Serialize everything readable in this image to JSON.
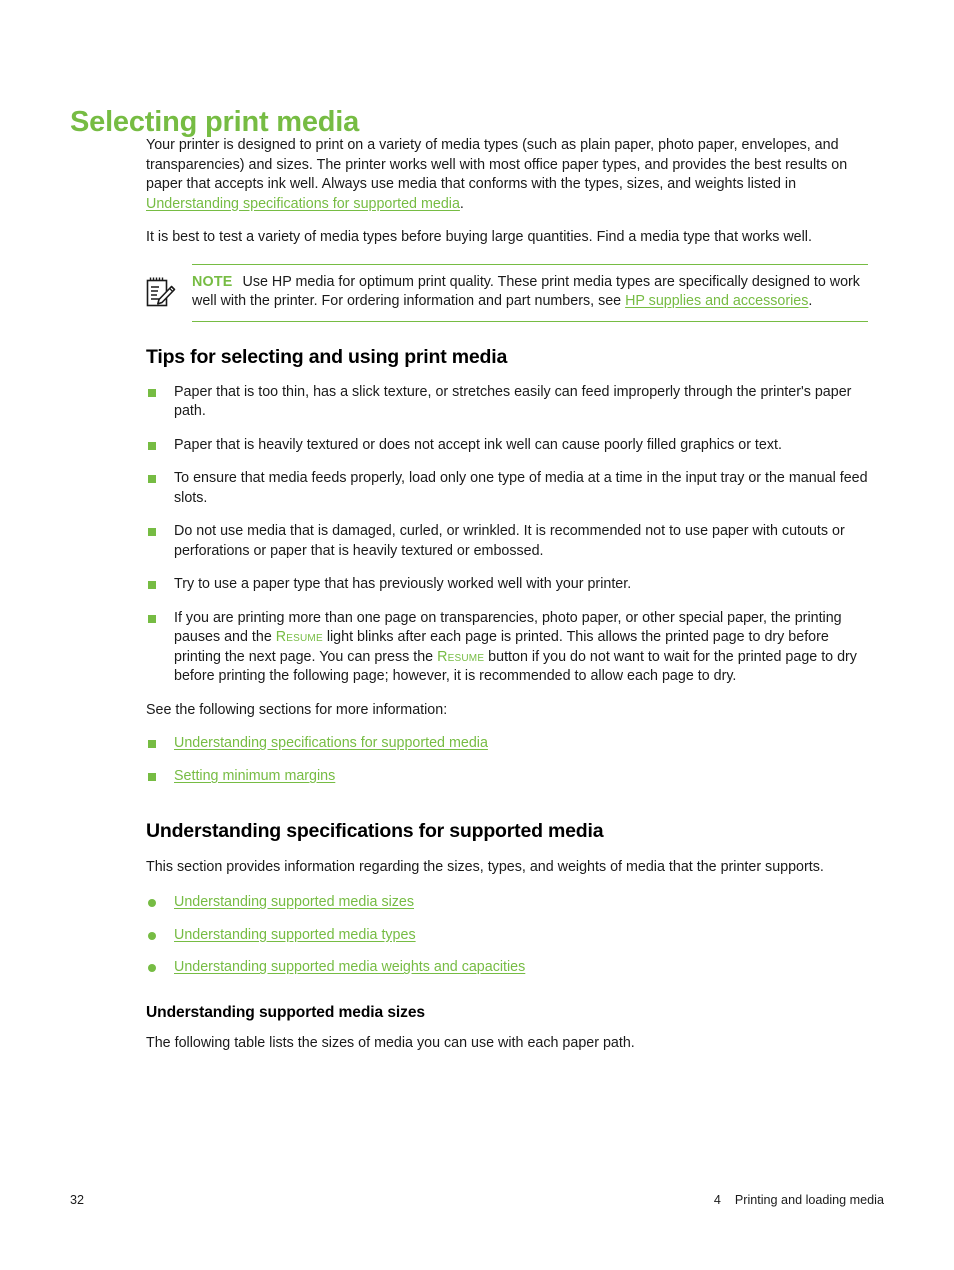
{
  "document": {
    "title": "Selecting print media"
  },
  "intro": {
    "paragraph_1_before_link": "Your printer is designed to print on a variety of media types (such as plain paper, photo paper, envelopes, and transparencies) and sizes. The printer works well with most office paper types, and provides the best results on paper that accepts ink well. Always use media that conforms with the types, sizes, and weights listed in ",
    "paragraph_1_link": "Understanding specifications for supported media",
    "paragraph_1_after_link": ".",
    "paragraph_2": "It is best to test a variety of media types before buying large quantities. Find a media type that works well."
  },
  "note": {
    "icon": "notepad-pencil-icon",
    "label": "NOTE",
    "text_before_link": "Use HP media for optimum print quality. These print media types are specifically designed to work well with the printer. For ordering information and part numbers, see ",
    "link": "HP supplies and accessories",
    "text_after_link": "."
  },
  "tips_section": {
    "heading": "Tips for selecting and using print media",
    "bullets": [
      {
        "text": "Paper that is too thin, has a slick texture, or stretches easily can feed improperly through the printer's paper path."
      },
      {
        "text": "Paper that is heavily textured or does not accept ink well can cause poorly filled graphics or text."
      },
      {
        "text": "To ensure that media feeds properly, load only one type of media at a time in the input tray or the manual feed slots."
      },
      {
        "text": "Do not use media that is damaged, curled, or wrinkled. It is recommended not to use paper with cutouts or perforations or paper that is heavily textured or embossed."
      },
      {
        "text": "Try to use a paper type that has previously worked well with your printer."
      }
    ],
    "resume_bullet": {
      "part_1": "If you are printing more than one page on transparencies, photo paper, or other special paper, the printing pauses and the ",
      "keycap_1": "Resume",
      "part_2": " light blinks after each page is printed. This allows the printed page to dry before printing the next page. You can press the ",
      "keycap_2": "Resume",
      "part_3": " button if you do not want to wait for the printed page to dry before printing the following page; however, it is recommended to allow each page to dry."
    },
    "see_also_intro": "See the following sections for more information:",
    "see_also_links": [
      "Understanding specifications for supported media",
      "Setting minimum margins"
    ]
  },
  "specs_section": {
    "heading": "Understanding specifications for supported media",
    "paragraph": "This section provides information regarding the sizes, types, and weights of media that the printer supports.",
    "links": [
      "Understanding supported media sizes",
      "Understanding supported media types",
      "Understanding supported media weights and capacities"
    ],
    "subheading": "Understanding supported media sizes",
    "sub_paragraph": "The following table lists the sizes of media you can use with each paper path."
  },
  "footer": {
    "page_number": "32",
    "chapter_number": "4",
    "chapter_title": "Printing and loading media"
  },
  "colors": {
    "accent_green": "#76bc43",
    "link_green": "#76bc43",
    "text_black": "#1a1a1a"
  }
}
